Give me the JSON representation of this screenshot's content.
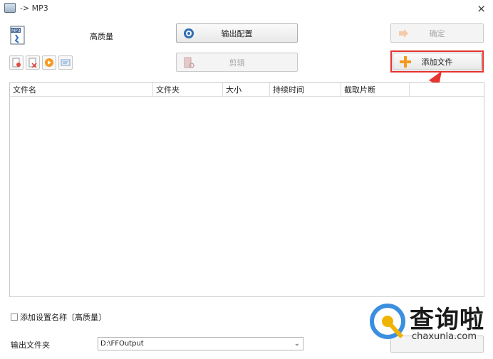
{
  "window": {
    "title": "-> MP3",
    "close_glyph": "×"
  },
  "format": {
    "icon": "mp3-file-icon",
    "quality": "高质量"
  },
  "buttons": {
    "output_config": "输出配置",
    "clip": "剪辑",
    "confirm": "确定",
    "add_file": "添加文件"
  },
  "small_toolbar": [
    {
      "name": "remove-file-button",
      "icon": "file-remove-icon"
    },
    {
      "name": "clear-list-button",
      "icon": "clear-icon"
    },
    {
      "name": "play-button",
      "icon": "play-icon"
    },
    {
      "name": "info-button",
      "icon": "info-icon"
    }
  ],
  "table": {
    "columns": [
      "文件名",
      "文件夹",
      "大小",
      "持续时间",
      "截取片断"
    ],
    "rows": []
  },
  "options": {
    "add_setting_name_label": "添加设置名称〔高质量〕",
    "add_setting_name_checked": false
  },
  "output": {
    "label": "输出文件夹",
    "folder": "D:\\FFOutput"
  },
  "watermark": {
    "brand": "查询啦",
    "url": "chaxunla.com"
  },
  "colors": {
    "highlight": "#e8332f",
    "add_icon": "#f39a1e"
  }
}
